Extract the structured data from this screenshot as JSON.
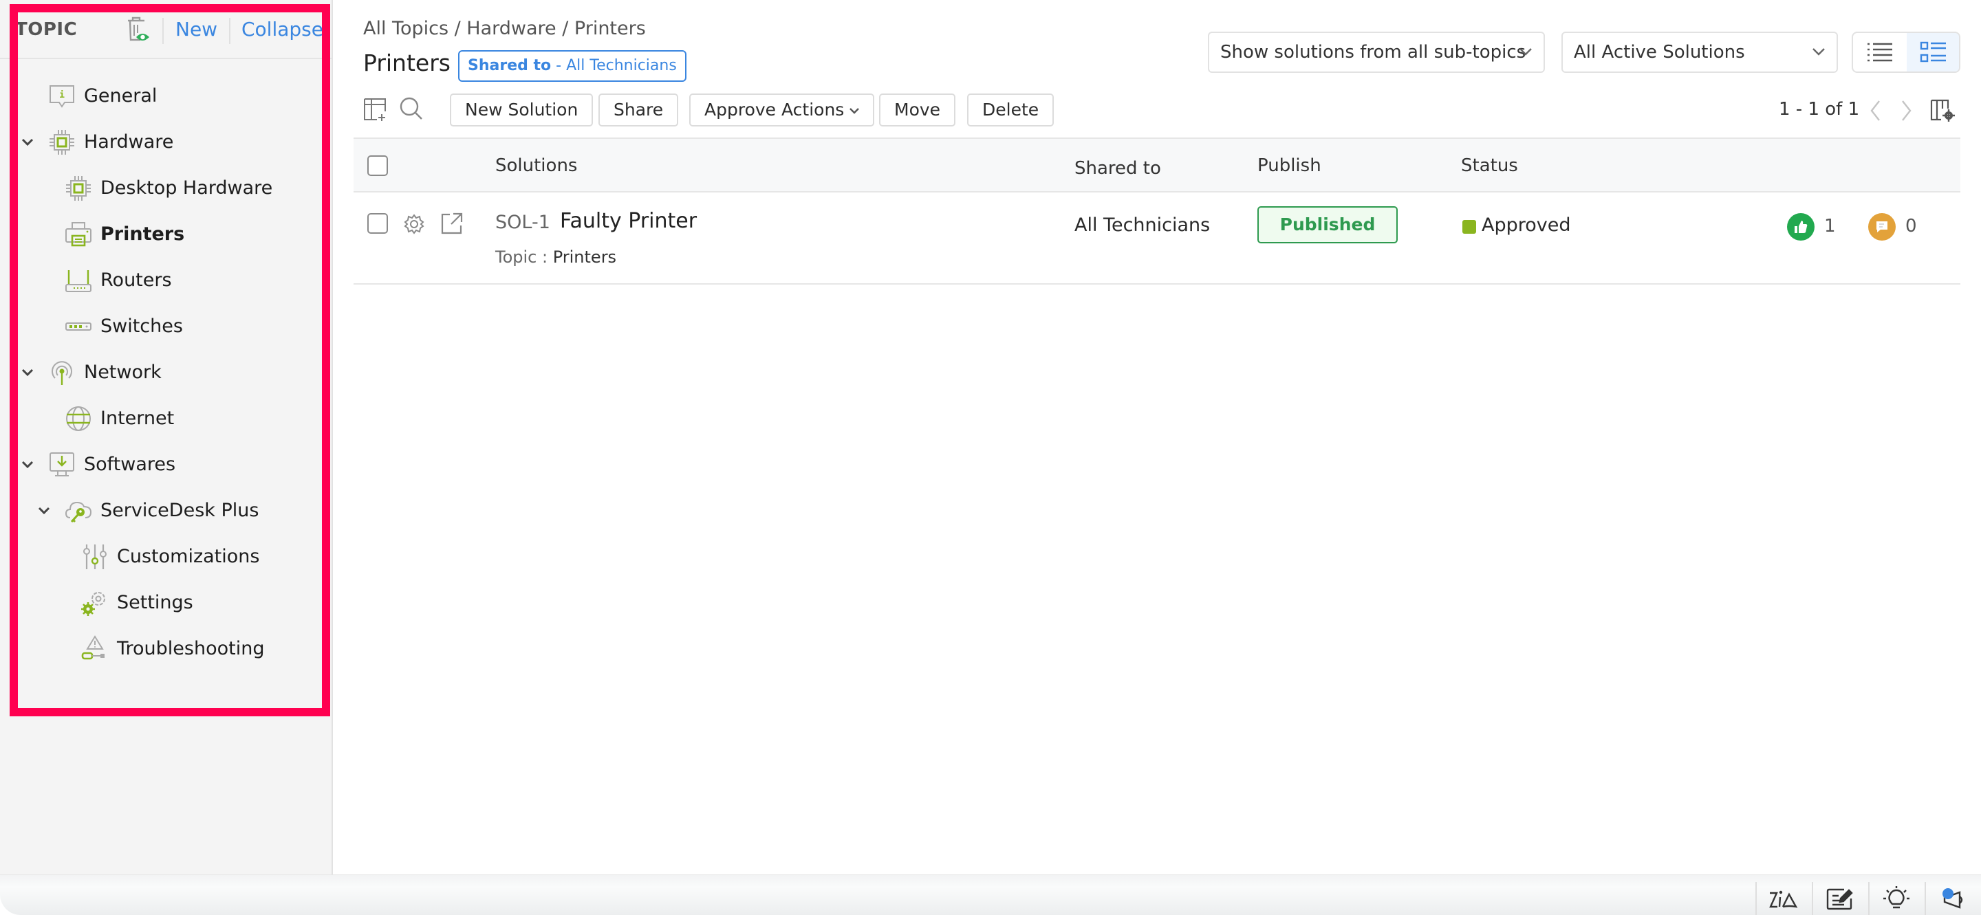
{
  "sidebar": {
    "header_label": "TOPIC",
    "new_label": "New",
    "collapse_label": "Collapse",
    "trash_icon": "trash-with-eye-icon",
    "items": [
      {
        "label": "General",
        "icon": "info-speech-bubble-icon",
        "level": 0,
        "expandable": false,
        "active": false
      },
      {
        "label": "Hardware",
        "icon": "cpu-chip-icon",
        "level": 0,
        "expandable": true,
        "expanded": true,
        "active": false
      },
      {
        "label": "Desktop Hardware",
        "icon": "cpu-chip-icon",
        "level": 1,
        "expandable": false,
        "active": false
      },
      {
        "label": "Printers",
        "icon": "printer-icon",
        "level": 1,
        "expandable": false,
        "active": true
      },
      {
        "label": "Routers",
        "icon": "router-icon",
        "level": 1,
        "expandable": false,
        "active": false
      },
      {
        "label": "Switches",
        "icon": "network-switch-icon",
        "level": 1,
        "expandable": false,
        "active": false
      },
      {
        "label": "Network",
        "icon": "antenna-signal-icon",
        "level": 0,
        "expandable": true,
        "expanded": true,
        "active": false
      },
      {
        "label": "Internet",
        "icon": "globe-icon",
        "level": 1,
        "expandable": false,
        "active": false
      },
      {
        "label": "Softwares",
        "icon": "monitor-download-icon",
        "level": 0,
        "expandable": true,
        "expanded": true,
        "active": false
      },
      {
        "label": "ServiceDesk Plus",
        "icon": "cloud-key-icon",
        "level": 1,
        "expandable": true,
        "expanded": true,
        "active": false
      },
      {
        "label": "Customizations",
        "icon": "sliders-icon",
        "level": 2,
        "expandable": false,
        "active": false
      },
      {
        "label": "Settings",
        "icon": "gears-icon",
        "level": 2,
        "expandable": false,
        "active": false
      },
      {
        "label": "Troubleshooting",
        "icon": "warning-tool-icon",
        "level": 2,
        "expandable": false,
        "active": false
      }
    ]
  },
  "header": {
    "breadcrumb": "All Topics / Hardware / Printers",
    "title": "Printers",
    "shared_badge_key": "Shared to",
    "shared_badge_value": " - All Technicians",
    "filter_subtopics": "Show solutions from all sub-topics",
    "filter_status": "All Active Solutions",
    "view_modes": [
      "list-view-icon",
      "detail-view-icon"
    ],
    "selected_view": "detail-view-icon"
  },
  "toolbar": {
    "new_solution": "New Solution",
    "share": "Share",
    "approve_actions": "Approve Actions",
    "move": "Move",
    "delete": "Delete",
    "pagination": "1 - 1 of 1",
    "icons": [
      "table-add-column-icon",
      "search-icon",
      "chevron-left-icon",
      "chevron-right-icon",
      "column-settings-icon"
    ]
  },
  "table": {
    "columns": [
      "Solutions",
      "Shared to",
      "Publish",
      "Status"
    ],
    "rows": [
      {
        "id": "SOL-1",
        "title": "Faulty Printer",
        "topic_label": "Topic : ",
        "topic": "Printers",
        "shared_to": "All Technicians",
        "publish": "Published",
        "status": "Approved",
        "likes": "1",
        "comments": "0"
      }
    ]
  },
  "colors": {
    "accent": "#3a86e0",
    "highlight_border": "#ff0050",
    "icon_green": "#8ab51f",
    "published_green": "#2e9a4f",
    "like_green": "#22a94f",
    "comment_orange": "#e3a23a"
  },
  "footer": {
    "buttons": [
      "zia-icon",
      "notes-edit-icon",
      "lightbulb-icon",
      "announcement-icon"
    ]
  }
}
